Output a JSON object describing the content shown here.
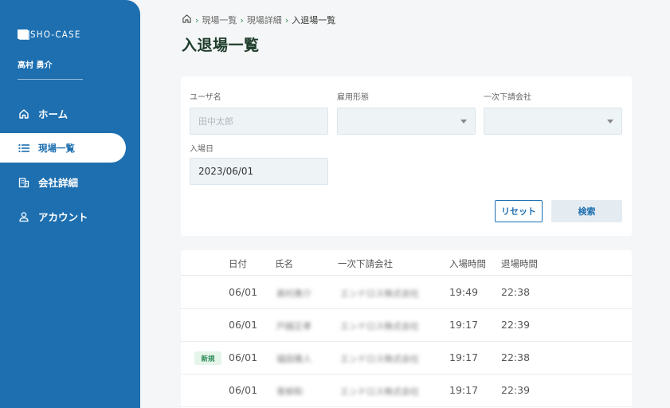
{
  "sidebar": {
    "brand": "SHO-CASE",
    "user_name": "高村 勇介",
    "items": [
      {
        "label": "ホーム",
        "icon": "home-icon"
      },
      {
        "label": "現場一覧",
        "icon": "list-icon",
        "active": true
      },
      {
        "label": "会社詳細",
        "icon": "building-icon"
      },
      {
        "label": "アカウント",
        "icon": "person-icon"
      }
    ],
    "colors": {
      "background": "#1d6fb0",
      "active_text": "#1d6fb0"
    }
  },
  "breadcrumb": {
    "sep": "›",
    "items": [
      "現場一覧",
      "現場詳細",
      "入退場一覧"
    ]
  },
  "page_title": "入退場一覧",
  "filters": {
    "user_name": {
      "label": "ユーザ名",
      "placeholder": "田中太郎"
    },
    "employment_type": {
      "label": "雇用形態",
      "value": ""
    },
    "subcontractor": {
      "label": "一次下請会社",
      "value": ""
    },
    "entry_date": {
      "label": "入場日",
      "value": "2023/06/01"
    },
    "reset_label": "リセット",
    "search_label": "検索"
  },
  "table": {
    "headers": {
      "date": "日付",
      "name": "氏名",
      "company": "一次下請会社",
      "in_time": "入場時間",
      "out_time": "退場時間"
    },
    "rows": [
      {
        "badge": "",
        "date": "06/01",
        "name": "高村勇介",
        "company": "エンドロス株式会社",
        "in_time": "19:49",
        "out_time": "22:38"
      },
      {
        "badge": "",
        "date": "06/01",
        "name": "戸越正孝",
        "company": "エンドロス株式会社",
        "in_time": "19:17",
        "out_time": "22:39"
      },
      {
        "badge": "新規",
        "date": "06/01",
        "name": "福田雅人",
        "company": "エンドロス株式会社",
        "in_time": "19:17",
        "out_time": "22:38"
      },
      {
        "badge": "",
        "date": "06/01",
        "name": "青柳和",
        "company": "エンドロス株式会社",
        "in_time": "19:17",
        "out_time": "22:39"
      }
    ]
  }
}
